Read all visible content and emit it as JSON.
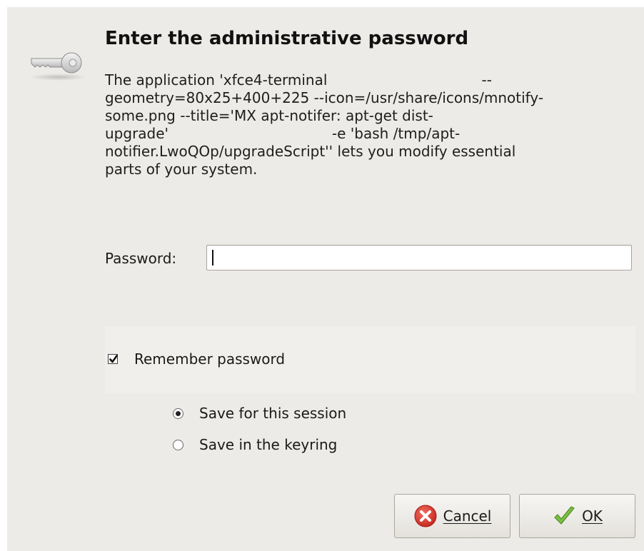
{
  "dialog": {
    "title": "Enter the administrative password",
    "message_lines": [
      "The application 'xfce4-terminal                                  --",
      "geometry=80x25+400+225 --icon=/usr/share/icons/mnotify-",
      "some.png --title='MX apt-notifer: apt-get dist-",
      "upgrade'                                    -e 'bash /tmp/apt-",
      "notifier.LwoQOp/upgradeScript'' lets you modify essential",
      "parts of your system."
    ],
    "icons": {
      "header": "key-icon",
      "cancel": "cancel-icon",
      "ok": "checkmark-icon"
    }
  },
  "password": {
    "label": "Password:",
    "value": ""
  },
  "remember": {
    "label": "Remember password",
    "checked": true,
    "options": [
      {
        "label": "Save for this session",
        "selected": true
      },
      {
        "label": "Save in the keyring",
        "selected": false
      }
    ]
  },
  "buttons": {
    "cancel_label": "Cancel",
    "ok_label": "OK"
  },
  "colors": {
    "dialog_bg": "#edebe7",
    "panel_bg": "#f1efec",
    "cancel_red": "#d9342b",
    "ok_green": "#6fb43a"
  }
}
